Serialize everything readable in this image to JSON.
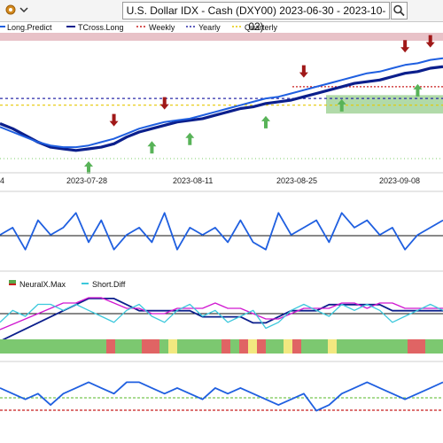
{
  "toolbar": {
    "title": "U.S. Dollar IDX - Cash (DXY00) 2023-06-30 - 2023-10-02)"
  },
  "icons": [
    "gear-icon",
    "chevron-down-icon",
    "search-icon"
  ],
  "colors": {
    "price": "#0b1f8c",
    "forecast": "#1f5fe0",
    "up_arrow": "#58b358",
    "down_arrow": "#a01818",
    "weekly": "#c81e1e",
    "yearly": "#2a2aa8",
    "quarterly": "#e6c800",
    "green_zone": "#a3d39a",
    "neural_max": "#d018d0",
    "short_diff": "#3cc8dc",
    "strip_green": "#7cc870",
    "strip_red": "#e06464",
    "strip_yellow": "#f2e880"
  },
  "chart_data": [
    {
      "type": "line",
      "panel": "price",
      "legend": [
        "Long.Predict",
        "TCross.Long",
        "Weekly",
        "Yearly",
        "Quarterly"
      ],
      "x_ticks": [
        "4",
        "2023-07-28",
        "2023-08-11",
        "2023-08-25",
        "2023-09-08"
      ],
      "series": [
        {
          "name": "TCross.Long",
          "values": [
            102.4,
            102.1,
            101.7,
            101.3,
            101.0,
            100.9,
            100.8,
            100.9,
            101.0,
            101.2,
            101.6,
            101.9,
            102.1,
            102.3,
            102.5,
            102.6,
            102.7,
            102.9,
            103.1,
            103.3,
            103.4,
            103.6,
            103.7,
            103.8,
            104.0,
            104.2,
            104.4,
            104.6,
            104.8,
            104.9,
            105.0,
            105.2,
            105.4,
            105.5,
            105.7,
            105.8
          ]
        },
        {
          "name": "Long.Predict",
          "values": [
            102.2,
            101.9,
            101.6,
            101.3,
            101.1,
            101.0,
            101.0,
            101.1,
            101.3,
            101.5,
            101.8,
            102.1,
            102.3,
            102.5,
            102.6,
            102.7,
            102.9,
            103.1,
            103.3,
            103.5,
            103.7,
            103.9,
            104.0,
            104.2,
            104.4,
            104.6,
            104.8,
            105.0,
            105.2,
            105.4,
            105.5,
            105.7,
            105.9,
            106.0,
            106.2,
            106.3
          ]
        }
      ],
      "levels": {
        "weekly": 104.6,
        "yearly": 103.9,
        "quarterly": 103.5
      },
      "up_arrows": [
        7,
        12,
        15,
        21,
        27,
        33
      ],
      "down_arrows": [
        9,
        13,
        24,
        32,
        34
      ]
    },
    {
      "type": "line",
      "panel": "oscillator-1",
      "series": [
        {
          "name": "",
          "values": [
            0,
            1,
            -2,
            2,
            0,
            1,
            3,
            -1,
            2,
            -2,
            0,
            1,
            -1,
            3,
            -2,
            1,
            0,
            1,
            -1,
            2,
            -1,
            -2,
            3,
            0,
            1,
            2,
            -1,
            3,
            1,
            2,
            0,
            1,
            -2,
            0,
            1,
            2
          ]
        }
      ],
      "baseline": 0
    },
    {
      "type": "line",
      "panel": "oscillator-2",
      "legend": [
        "NeuralX.Max",
        "Short.Diff"
      ],
      "series": [
        {
          "name": "NeuralX.Max",
          "values": [
            -3,
            -2,
            -1,
            0,
            1,
            2,
            2,
            3,
            3,
            2,
            1,
            1,
            0,
            0,
            1,
            1,
            1,
            2,
            1,
            1,
            0,
            -1,
            -1,
            0,
            1,
            1,
            1,
            2,
            2,
            1,
            2,
            2,
            1,
            1,
            1,
            1
          ]
        },
        {
          "name": "Short.Diff",
          "values": [
            -1,
            1,
            0,
            2,
            2,
            1,
            2,
            1,
            0,
            -1,
            1,
            2,
            0,
            -1,
            1,
            2,
            0,
            1,
            -1,
            0,
            1,
            -2,
            -1,
            1,
            2,
            1,
            0,
            2,
            1,
            2,
            1,
            -1,
            0,
            1,
            2,
            1
          ]
        },
        {
          "name": "",
          "values": [
            -4,
            -3,
            -2,
            -1,
            0,
            1,
            2,
            3,
            3,
            3,
            2,
            1,
            1,
            1,
            1,
            1,
            0,
            0,
            0,
            0,
            -1,
            -1,
            0,
            1,
            1,
            1,
            2,
            2,
            2,
            2,
            2,
            1,
            1,
            1,
            1,
            1
          ]
        }
      ],
      "strip": [
        "g",
        "g",
        "g",
        "g",
        "g",
        "g",
        "g",
        "g",
        "g",
        "g",
        "g",
        "g",
        "r",
        "g",
        "g",
        "g",
        "r",
        "r",
        "g",
        "y",
        "g",
        "g",
        "g",
        "g",
        "g",
        "r",
        "g",
        "r",
        "y",
        "r",
        "g",
        "g",
        "y",
        "r",
        "g",
        "g",
        "g",
        "y",
        "g",
        "g",
        "g",
        "g",
        "g",
        "g",
        "g",
        "g",
        "r",
        "r",
        "g",
        "g"
      ]
    },
    {
      "type": "line",
      "panel": "oscillator-3",
      "series": [
        {
          "name": "",
          "values": [
            2,
            1,
            0,
            1,
            -1,
            1,
            2,
            3,
            2,
            1,
            3,
            3,
            2,
            1,
            2,
            1,
            0,
            2,
            1,
            2,
            1,
            0,
            -1,
            0,
            1,
            -2,
            -1,
            1,
            2,
            3,
            2,
            1,
            0,
            1,
            2,
            3
          ]
        }
      ],
      "levels": {
        "green": 0.3,
        "red": -0.8
      }
    }
  ]
}
